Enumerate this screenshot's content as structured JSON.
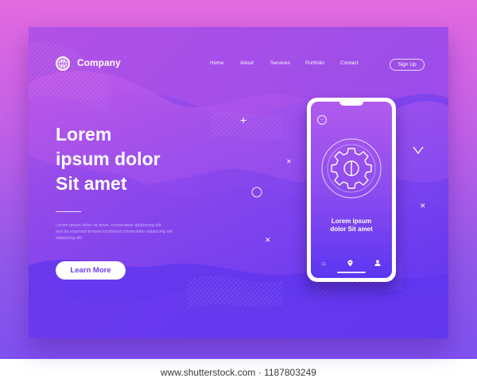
{
  "brand": {
    "name": "Company",
    "logo_icon": "basketball-icon"
  },
  "nav": {
    "links": [
      "Home",
      "About",
      "Services",
      "Portfolio",
      "Contact"
    ],
    "signup_label": "Sign Up"
  },
  "hero": {
    "headline": [
      "Lorem",
      "ipsum dolor",
      "Sit amet"
    ],
    "body": [
      "Lorem ipsum dolor sit amet, consectetur adipiscing elit",
      "sed do eiusmod tempor incididunt consectetur adipiscing elit",
      "adipiscing elit"
    ],
    "cta_label": "Learn More"
  },
  "phone": {
    "menu_icon": "more-dots-icon",
    "center_icon": "gear-icon",
    "title": [
      "Lorem ipsum",
      "dolor Sit amet"
    ],
    "bottom_icons": [
      "home-icon",
      "location-pin-icon",
      "user-icon"
    ]
  },
  "watermark": "www.shutterstock.com · 1187803249",
  "colors": {
    "accent": "#6a3cf0",
    "card_top": "#b04fe6",
    "card_bottom": "#6a3cf0",
    "text": "#ffffff"
  }
}
